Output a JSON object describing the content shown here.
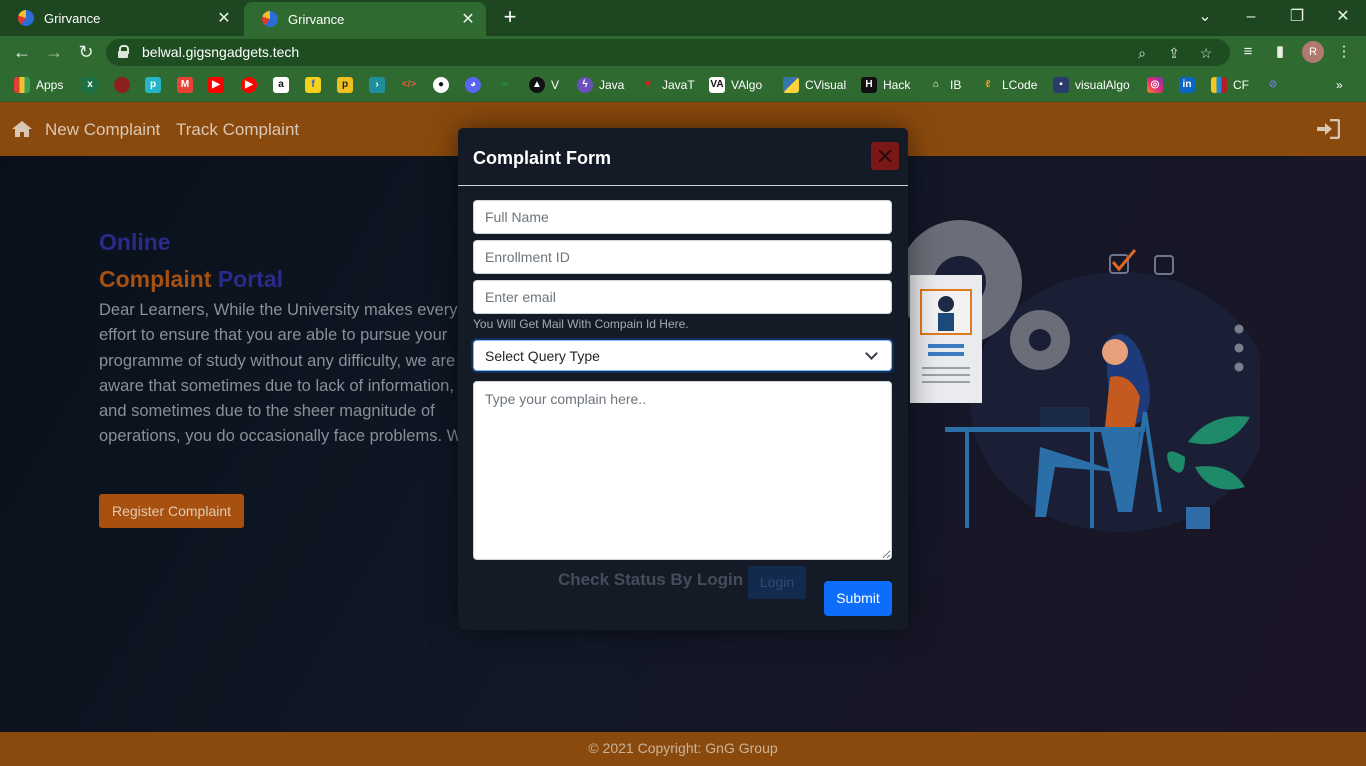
{
  "browser": {
    "tabs": [
      {
        "title": "Grirvance",
        "active": false
      },
      {
        "title": "Grirvance",
        "active": true
      }
    ],
    "url": "belwal.gigsngadgets.tech",
    "profile_initial": "R",
    "bookmarks": [
      {
        "label": "Apps",
        "icon": "apps-grid-icon"
      },
      {
        "label": "",
        "icon": "excel-icon"
      },
      {
        "label": "",
        "icon": "red-bookmark-icon"
      },
      {
        "label": "",
        "icon": "tplink-icon"
      },
      {
        "label": "",
        "icon": "gmail-icon"
      },
      {
        "label": "",
        "icon": "youtube-icon"
      },
      {
        "label": "",
        "icon": "youtube-music-icon"
      },
      {
        "label": "",
        "icon": "amazon-icon"
      },
      {
        "label": "",
        "icon": "flipkart-icon"
      },
      {
        "label": "",
        "icon": "p-icon"
      },
      {
        "label": "",
        "icon": "arrow-bookmark-icon"
      },
      {
        "label": "",
        "icon": "code-icon"
      },
      {
        "label": "",
        "icon": "github-icon"
      },
      {
        "label": "",
        "icon": "discord-icon"
      },
      {
        "label": "",
        "icon": "gfg-icon"
      },
      {
        "label": "V",
        "icon": "triangle-icon"
      },
      {
        "label": "Java",
        "icon": "bolt-icon"
      },
      {
        "label": "JavaT",
        "icon": "javat-icon"
      },
      {
        "label": "VAlgo",
        "icon": "valgo-icon"
      },
      {
        "label": "CVisual",
        "icon": "python-icon"
      },
      {
        "label": "Hack",
        "icon": "hackerrank-icon"
      },
      {
        "label": "IB",
        "icon": "ib-icon"
      },
      {
        "label": "LCode",
        "icon": "leetcode-icon"
      },
      {
        "label": "visualAlgo",
        "icon": "visualalgo-icon"
      },
      {
        "label": "",
        "icon": "instagram-icon"
      },
      {
        "label": "",
        "icon": "linkedin-icon"
      },
      {
        "label": "CF",
        "icon": "codeforces-icon"
      },
      {
        "label": "",
        "icon": "link-bookmark-icon"
      }
    ],
    "colors": {
      "frame": "#1e4620",
      "toolbar": "#2f6a31"
    }
  },
  "site": {
    "nav": {
      "new_complaint": "New Complaint",
      "track_complaint": "Track Complaint"
    },
    "hero": {
      "online": "Online",
      "title_part1": "Complaint",
      "title_part2": "Portal",
      "text": "Dear Learners, While the University makes every effort to ensure that you are able to pursue your programme of study without any difficulty, we are aware that sometimes due to lack of information, and sometimes due to the sheer magnitude of operations, you do occasionally face problems. We hope that this platform shall help us in addressing your concerns in the shortest possible time, allowing you all your time to focus on studies.",
      "register_button": "Register Complaint"
    },
    "footer": "© 2021 Copyright: GnG Group",
    "colors": {
      "brand": "#8b4a0d",
      "accent_blue": "#2a2a8a"
    }
  },
  "modal": {
    "title": "Complaint Form",
    "full_name_placeholder": "Full Name",
    "enrollment_placeholder": "Enrollment ID",
    "email_placeholder": "Enter email",
    "email_hint": "You Will Get Mail With Compain Id Here.",
    "query_type_selected": "Select Query Type",
    "complaint_placeholder": "Type your complain here..",
    "behind_status_text": "Check Status By Login",
    "behind_login_button": "Login",
    "submit_label": "Submit"
  }
}
